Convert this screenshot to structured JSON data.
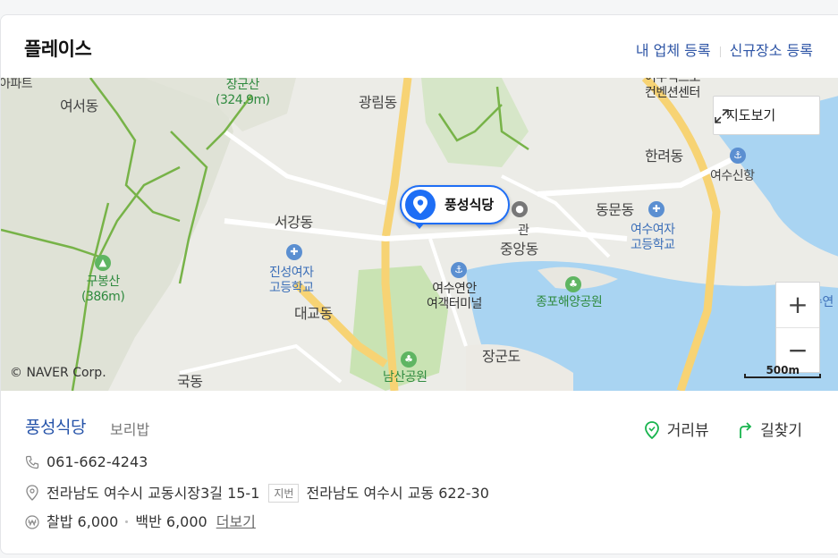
{
  "header": {
    "title": "플레이스",
    "register_business": "내 업체 등록",
    "register_new": "신규장소 등록"
  },
  "map": {
    "labels": {
      "yeoseo": "여서동",
      "janggunsan": "장군산",
      "janggunsan_height": "(324.9m)",
      "gwangrim": "광림동",
      "expo_line1": "여수엑스포",
      "expo_line2": "컨벤션센터",
      "hanryeo": "한려동",
      "yeosu_port": "여수신항",
      "seogang": "서강동",
      "dongmun": "동문동",
      "yeosu_girls_hs_line1": "여수여자",
      "yeosu_girls_hs_line2": "고등학교",
      "gubongsan": "구봉산",
      "gubongsan_height": "(386m)",
      "jinseong_line1": "진성여자",
      "jinseong_line2": "고등학교",
      "jungang": "중앙동",
      "terminal_line1": "여수연안",
      "terminal_line2": "여객터미널",
      "jongpo": "종포해양공원",
      "daegyo": "대교동",
      "janggundo": "장군도",
      "namsan": "남산공원",
      "guk": "국동",
      "gwan_fragment": "관",
      "apt_fragment": "아파트",
      "sea_fragment": "수연"
    },
    "marker_label": "풍성식당",
    "view_map_button": "지도보기",
    "zoom_in": "+",
    "zoom_out": "−",
    "copyright": "© NAVER Corp.",
    "scale": "500m"
  },
  "place": {
    "name": "풍성식당",
    "category": "보리밥",
    "actions": {
      "street_view": "거리뷰",
      "directions": "길찾기"
    },
    "phone": "061-662-4243",
    "road_address": "전라남도 여수시 교동시장3길 15-1",
    "lot_chip": "지번",
    "lot_address": "전라남도 여수시 교동 622-30",
    "menu": [
      {
        "name": "찰밥",
        "price": "6,000"
      },
      {
        "name": "백반",
        "price": "6,000"
      }
    ],
    "more": "더보기"
  },
  "colors": {
    "link": "#2553a9",
    "marker": "#1e6ef5",
    "water": "#a9d4f2",
    "road": "#f7d374",
    "park": "#c9e3b3",
    "action_green": "#18b44e"
  }
}
